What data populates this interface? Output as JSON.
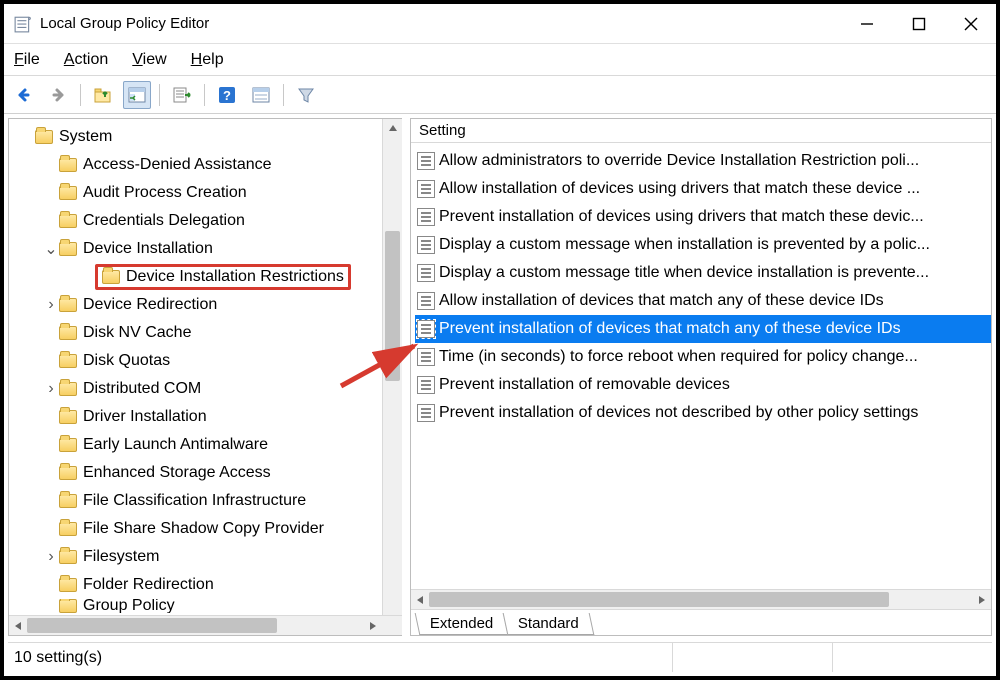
{
  "window": {
    "title": "Local Group Policy Editor"
  },
  "menus": {
    "file": {
      "label": "File",
      "hotidx": 0
    },
    "action": {
      "label": "Action",
      "hotidx": 0
    },
    "view": {
      "label": "View",
      "hotidx": 0
    },
    "help": {
      "label": "Help",
      "hotidx": 0
    }
  },
  "toolbar_icons": {
    "back": "back-arrow-icon",
    "forward": "forward-arrow-icon",
    "up": "up-folder-icon",
    "console": "console-tree-icon",
    "export": "export-list-icon",
    "help": "help-icon",
    "properties": "properties-icon",
    "filter": "filter-icon"
  },
  "tree": {
    "root": "System",
    "items": [
      {
        "label": "Access-Denied Assistance"
      },
      {
        "label": "Audit Process Creation"
      },
      {
        "label": "Credentials Delegation"
      },
      {
        "label": "Device Installation",
        "expanded": true,
        "children": [
          {
            "label": "Device Installation Restrictions",
            "highlight": true
          }
        ]
      },
      {
        "label": "Device Redirection",
        "expandable": true
      },
      {
        "label": "Disk NV Cache"
      },
      {
        "label": "Disk Quotas"
      },
      {
        "label": "Distributed COM",
        "expandable": true
      },
      {
        "label": "Driver Installation"
      },
      {
        "label": "Early Launch Antimalware"
      },
      {
        "label": "Enhanced Storage Access"
      },
      {
        "label": "File Classification Infrastructure"
      },
      {
        "label": "File Share Shadow Copy Provider"
      },
      {
        "label": "Filesystem",
        "expandable": true
      },
      {
        "label": "Folder Redirection"
      },
      {
        "label": "Group Policy",
        "cut": true
      }
    ]
  },
  "settings": {
    "column_label": "Setting",
    "rows": [
      "Allow administrators to override Device Installation Restriction poli...",
      "Allow installation of devices using drivers that match these device ...",
      "Prevent installation of devices using drivers that match these devic...",
      "Display a custom message when installation is prevented by a polic...",
      "Display a custom message title when device installation is prevente...",
      "Allow installation of devices that match any of these device IDs",
      "Prevent installation of devices that match any of these device IDs",
      "Time (in seconds) to force reboot when required for policy change...",
      "Prevent installation of removable devices",
      "Prevent installation of devices not described by other policy settings"
    ],
    "selected_index": 6
  },
  "tabs": {
    "extended": "Extended",
    "standard": "Standard",
    "active": "Standard"
  },
  "status": {
    "text": "10 setting(s)"
  }
}
